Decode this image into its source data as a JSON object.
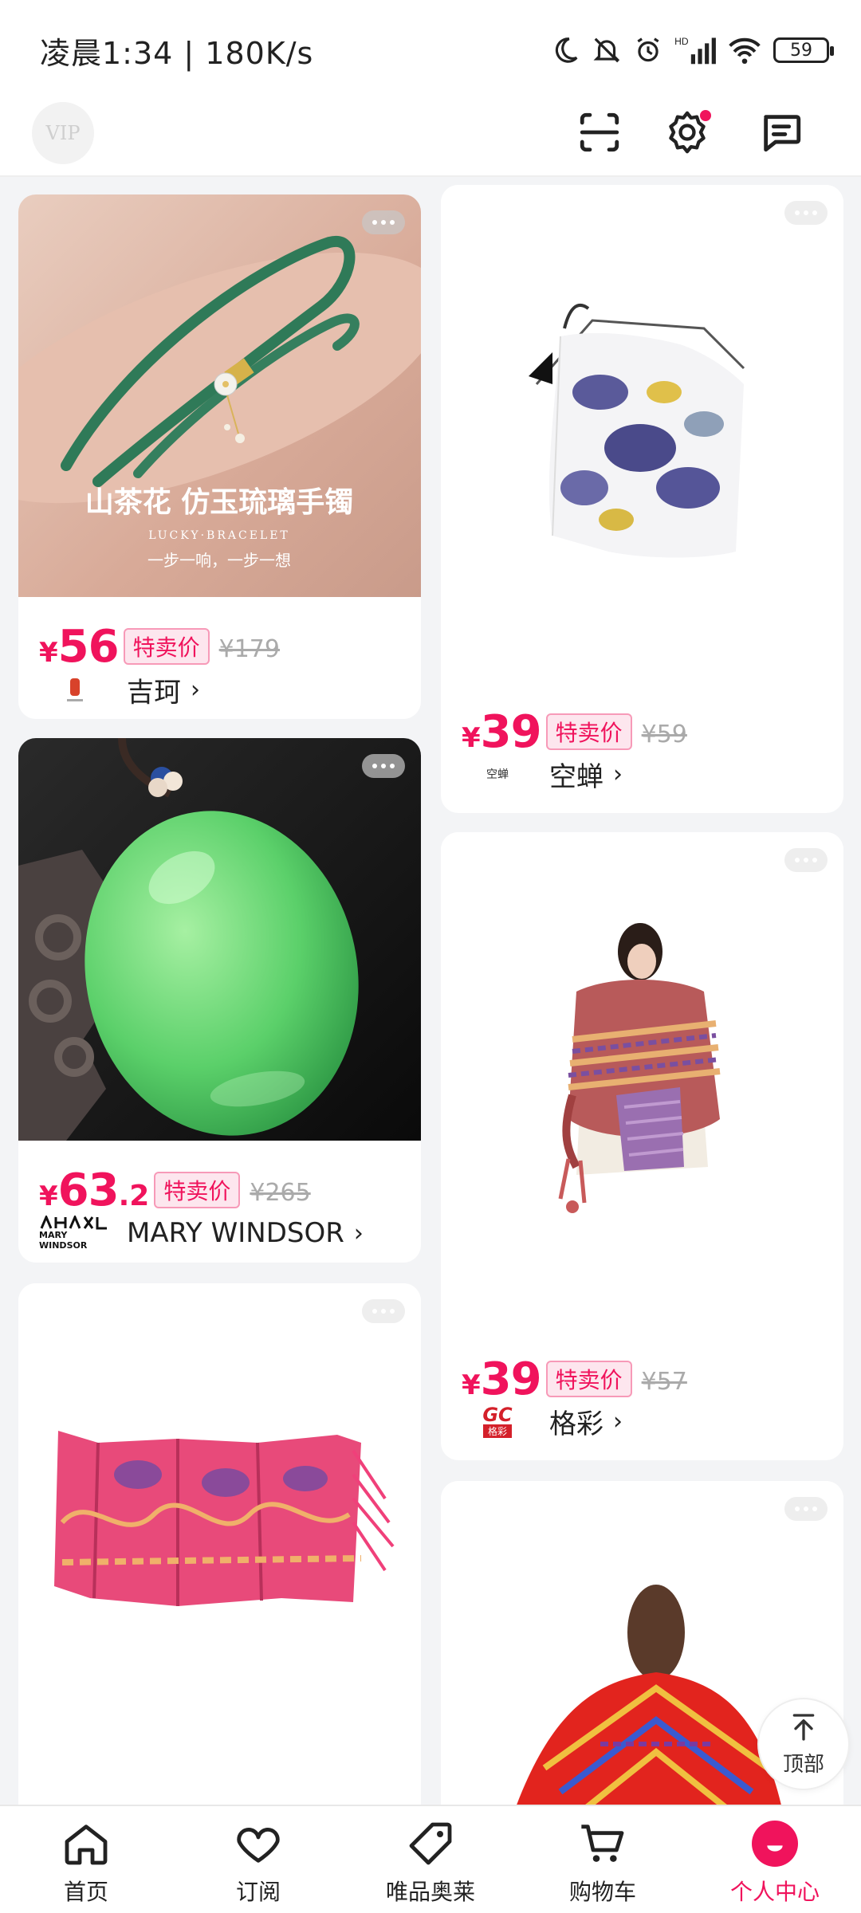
{
  "status_bar": {
    "time": "凌晨1:34 | 180K/s",
    "battery": "59"
  },
  "header": {
    "vip_label": "VIP"
  },
  "products": [
    {
      "currency": "¥",
      "price": "56",
      "price_decimal": "",
      "tag": "特卖价",
      "original_price": "¥179",
      "brand": "吉珂",
      "image_caption": "山茶花 仿玉琉璃手镯",
      "image_subcaption": "LUCKY·BRACELET",
      "image_slogan": "一步一响，一步一想"
    },
    {
      "currency": "¥",
      "price": "39",
      "price_decimal": "",
      "tag": "特卖价",
      "original_price": "¥59",
      "brand": "空蝉",
      "brand_logo_text": "空蝉"
    },
    {
      "currency": "¥",
      "price": "63",
      "price_decimal": ".2",
      "tag": "特卖价",
      "original_price": "¥265",
      "brand": "MARY WINDSOR",
      "brand_logo_text": "MARY WINDSOR"
    },
    {
      "currency": "¥",
      "price": "39",
      "price_decimal": "",
      "tag": "特卖价",
      "original_price": "¥57",
      "brand": "格彩",
      "brand_logo_text": "GC",
      "brand_logo_sub": "格彩"
    }
  ],
  "back_to_top": {
    "label": "顶部"
  },
  "nav": {
    "items": [
      {
        "label": "首页"
      },
      {
        "label": "订阅"
      },
      {
        "label": "唯品奥莱"
      },
      {
        "label": "购物车"
      },
      {
        "label": "个人中心"
      }
    ]
  },
  "colors": {
    "accent": "#f0135c",
    "background": "#f3f4f6"
  }
}
